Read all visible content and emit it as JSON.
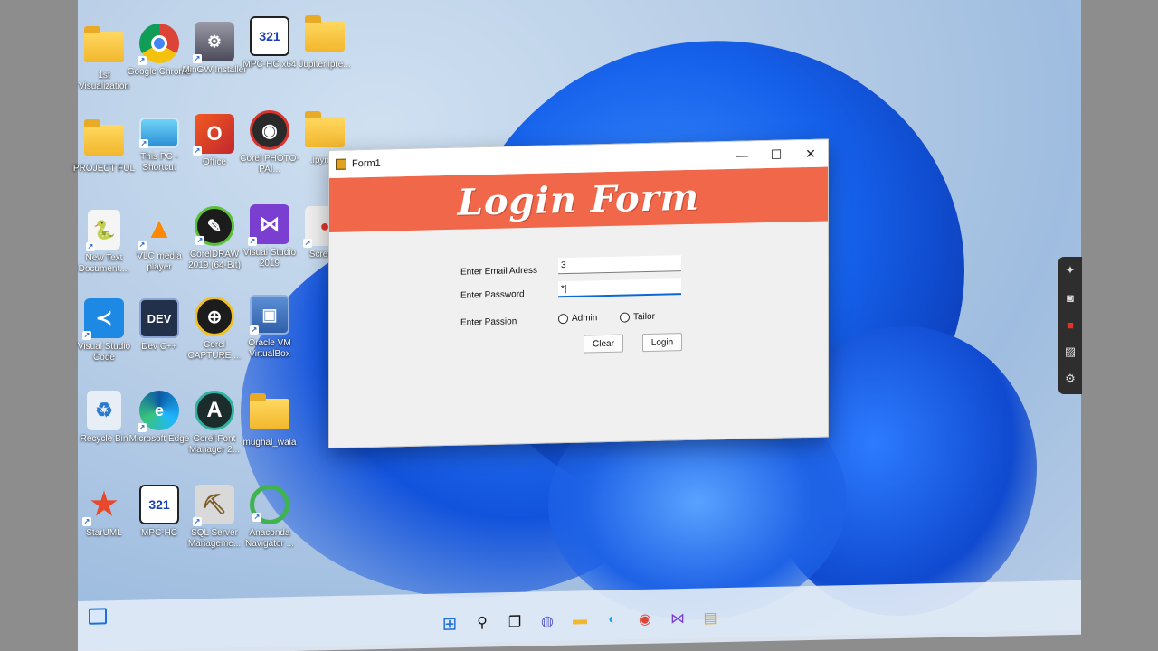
{
  "desktop": {
    "icons": [
      {
        "label": "1st Visualization",
        "kind": "folder"
      },
      {
        "label": "Google Chrome",
        "kind": "chrome"
      },
      {
        "label": "MinGW Installer",
        "kind": "app"
      },
      {
        "label": "MPC-HC x64",
        "kind": "mpc"
      },
      {
        "label": "Jupiter.ipre...",
        "kind": "folder"
      },
      {
        "label": "PROJECT FUL",
        "kind": "folder"
      },
      {
        "label": "This PC - Shortcut",
        "kind": "pc"
      },
      {
        "label": "Office",
        "kind": "office"
      },
      {
        "label": "Corel PHOTO-PAI...",
        "kind": "camera"
      },
      {
        "label": ".ipynb_",
        "kind": "folder"
      },
      {
        "label": "New Text Document....",
        "kind": "python"
      },
      {
        "label": "VLC media player",
        "kind": "vlc"
      },
      {
        "label": "CorelDRAW 2019 (64-Bit)",
        "kind": "coreldraw"
      },
      {
        "label": "Visual Studio 2019",
        "kind": "vs"
      },
      {
        "label": "Scree...",
        "kind": "screen"
      },
      {
        "label": "Visual Studio Code",
        "kind": "vscode"
      },
      {
        "label": "Dev C++",
        "kind": "devcpp"
      },
      {
        "label": "Corel CAPTURE ...",
        "kind": "capture"
      },
      {
        "label": "Oracle VM VirtualBox",
        "kind": "vbox"
      },
      {
        "label": "Recycle Bin",
        "kind": "bin"
      },
      {
        "label": "Microsoft Edge",
        "kind": "edge"
      },
      {
        "label": "Corel Font Manager 2...",
        "kind": "font"
      },
      {
        "label": "mughal_wala",
        "kind": "folder"
      },
      {
        "label": "StarUML",
        "kind": "star"
      },
      {
        "label": "MPC-HC",
        "kind": "mpc"
      },
      {
        "label": "SQL Server Manageme...",
        "kind": "sql"
      },
      {
        "label": "Anaconda Navigator ...",
        "kind": "anaconda"
      }
    ],
    "dev_text": "DEV",
    "mpc_text": "321",
    "font_text": "A"
  },
  "window": {
    "title": "Form1",
    "minimize": "—",
    "maximize": "☐",
    "close": "✕",
    "banner": "Login Form",
    "email_label": "Enter Email Adress",
    "email_value": "3",
    "password_label": "Enter Password",
    "password_value": "*|",
    "passion_label": "Enter Passion",
    "radio_admin": "Admin",
    "radio_tailor": "Tailor",
    "clear_button": "Clear",
    "login_button": "Login"
  },
  "colors": {
    "banner": "#f0674a",
    "focus": "#0b66d6"
  },
  "side_widget": [
    "pin-icon",
    "camera-icon",
    "record-icon",
    "gallery-icon",
    "settings-icon"
  ],
  "taskbar": [
    "start-icon",
    "search-icon",
    "taskview-icon",
    "chat-icon",
    "explorer-icon",
    "edge-icon",
    "chrome-icon",
    "vs-icon",
    "store-icon"
  ]
}
